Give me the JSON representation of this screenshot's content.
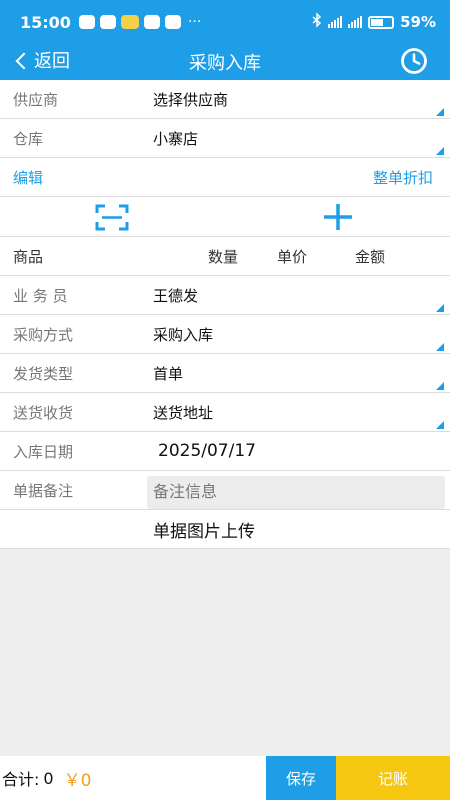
{
  "status_bar": {
    "time": "15:00",
    "dots": "···",
    "battery_pct": "59%"
  },
  "header": {
    "back_label": "返回",
    "title": "采购入库"
  },
  "supplier": {
    "label": "供应商",
    "value": "选择供应商"
  },
  "warehouse": {
    "label": "仓库",
    "value": "小寨店"
  },
  "actions": {
    "edit_label": "编辑",
    "discount_label": "整单折扣"
  },
  "table_header": {
    "product": "商品",
    "quantity": "数量",
    "unit_price": "单价",
    "amount": "金额"
  },
  "salesperson": {
    "label": "业 务 员",
    "value": "王德发"
  },
  "purchase_method": {
    "label": "采购方式",
    "value": "采购入库"
  },
  "shipping_type": {
    "label": "发货类型",
    "value": "首单"
  },
  "delivery": {
    "label": "送货收货",
    "value": "送货地址"
  },
  "inbound_date": {
    "label": "入库日期",
    "value": "2025/07/17"
  },
  "remarks": {
    "label": "单据备注",
    "placeholder": "备注信息"
  },
  "upload": {
    "label": "单据图片上传"
  },
  "footer": {
    "total_label": "合计:",
    "total_qty": "0",
    "total_amount": "￥0",
    "save_label": "保存",
    "post_label": "记账"
  },
  "colors": {
    "primary": "#1e9ee6",
    "accent": "#f6c710",
    "amount": "#f0a020"
  }
}
